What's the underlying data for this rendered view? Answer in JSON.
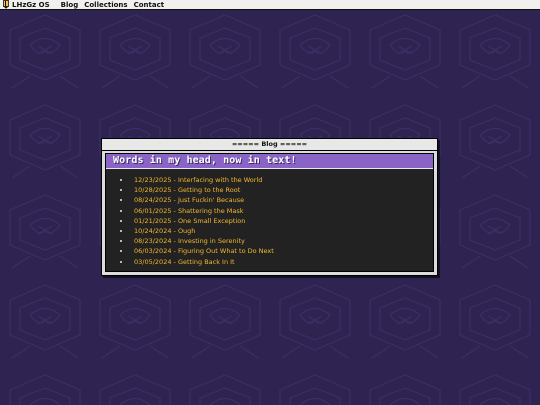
{
  "menubar": {
    "logo_icon": "pencil-icon",
    "os_name": "LHzGz OS",
    "items": [
      {
        "label": "Blog"
      },
      {
        "label": "Collections"
      },
      {
        "label": "Contact"
      }
    ]
  },
  "window": {
    "title": "===== Blog =====",
    "banner": "Words in my head, now in text!",
    "posts": [
      {
        "label": "12/23/2025 - Interfacing with the World"
      },
      {
        "label": "10/28/2025 - Getting to the Root"
      },
      {
        "label": "08/24/2025 - Just Fuckin' Because"
      },
      {
        "label": "06/01/2025 - Shattering the Mask"
      },
      {
        "label": "01/21/2025 - One Small Exception"
      },
      {
        "label": "10/24/2024 - Ough"
      },
      {
        "label": "08/23/2024 - Investing in Serenity"
      },
      {
        "label": "06/03/2024 - Figuring Out What to Do Next"
      },
      {
        "label": "03/05/2024 - Getting Back In It"
      }
    ]
  },
  "colors": {
    "desktop": "#2f2352",
    "banner": "#8a63c6",
    "link": "#f5b82e",
    "body": "#222222"
  }
}
